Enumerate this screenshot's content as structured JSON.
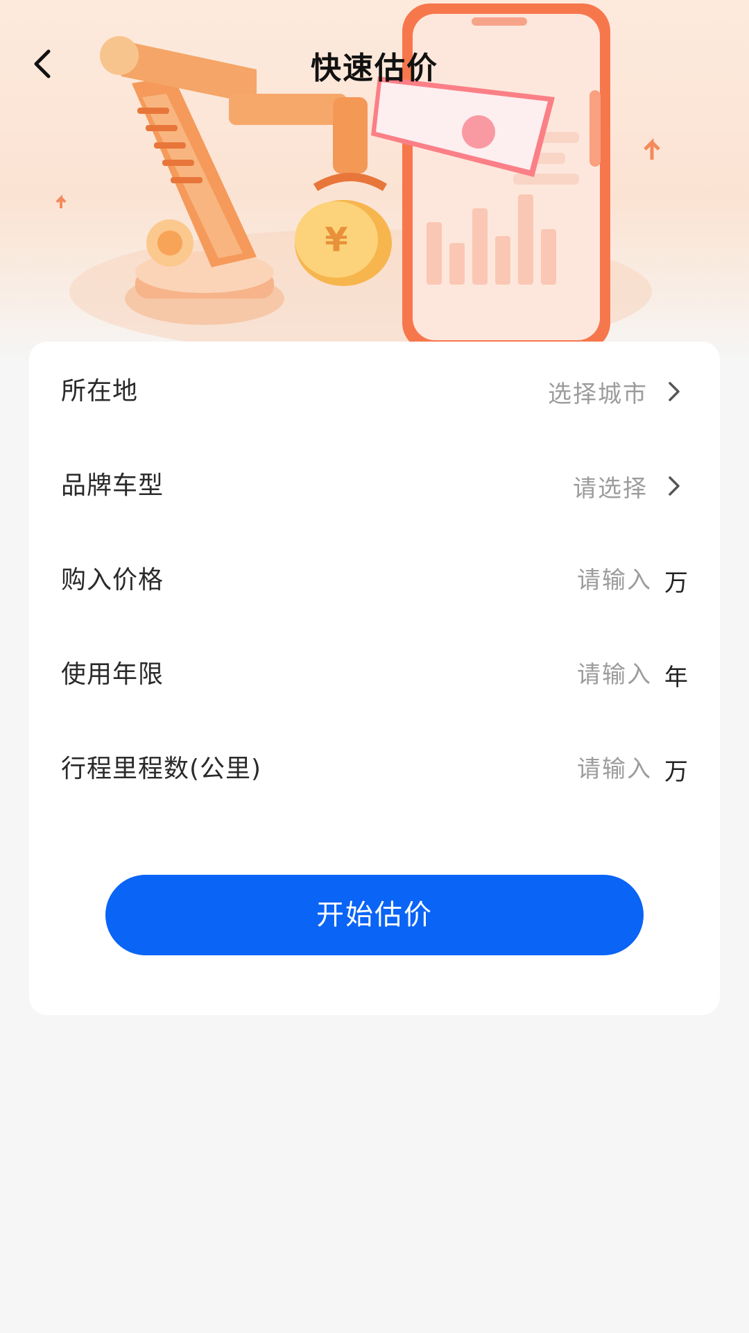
{
  "header": {
    "title": "快速估价",
    "back_icon": "chevron-left-icon"
  },
  "hero": {
    "illustration": "robot-arm-coin-phone-illustration",
    "accent_color": "#f7833c"
  },
  "form": {
    "rows": [
      {
        "label": "所在地",
        "value": "选择城市",
        "type": "select",
        "icon": "chevron-right-icon"
      },
      {
        "label": "品牌车型",
        "value": "请选择",
        "type": "select",
        "icon": "chevron-right-icon"
      },
      {
        "label": "购入价格",
        "placeholder": "请输入",
        "unit": "万",
        "type": "input"
      },
      {
        "label": "使用年限",
        "placeholder": "请输入",
        "unit": "年",
        "type": "input"
      },
      {
        "label": "行程里程数(公里)",
        "placeholder": "请输入",
        "unit": "万",
        "type": "input"
      }
    ]
  },
  "actions": {
    "submit_label": "开始估价",
    "submit_color": "#0a64f5"
  }
}
